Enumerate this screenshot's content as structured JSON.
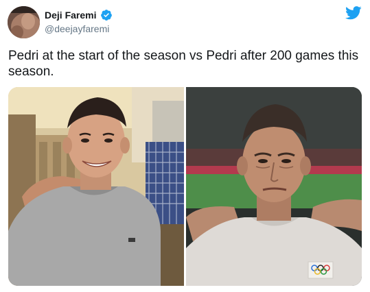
{
  "tweet": {
    "author": {
      "display_name": "Deji Faremi",
      "handle": "@deejayfaremi",
      "verified": true,
      "avatar_icon": "profile-avatar"
    },
    "platform_icon": "twitter-bird-icon",
    "text": "Pedri at the start of the season vs Pedri after 200 games this season.",
    "media": [
      {
        "kind": "photo",
        "subject": "smiling young man in grey t-shirt"
      },
      {
        "kind": "photo",
        "subject": "tired man in white jersey on football pitch"
      }
    ]
  },
  "colors": {
    "twitter_blue": "#1da1f2",
    "name_text": "#14171a",
    "handle_text": "#657786"
  }
}
